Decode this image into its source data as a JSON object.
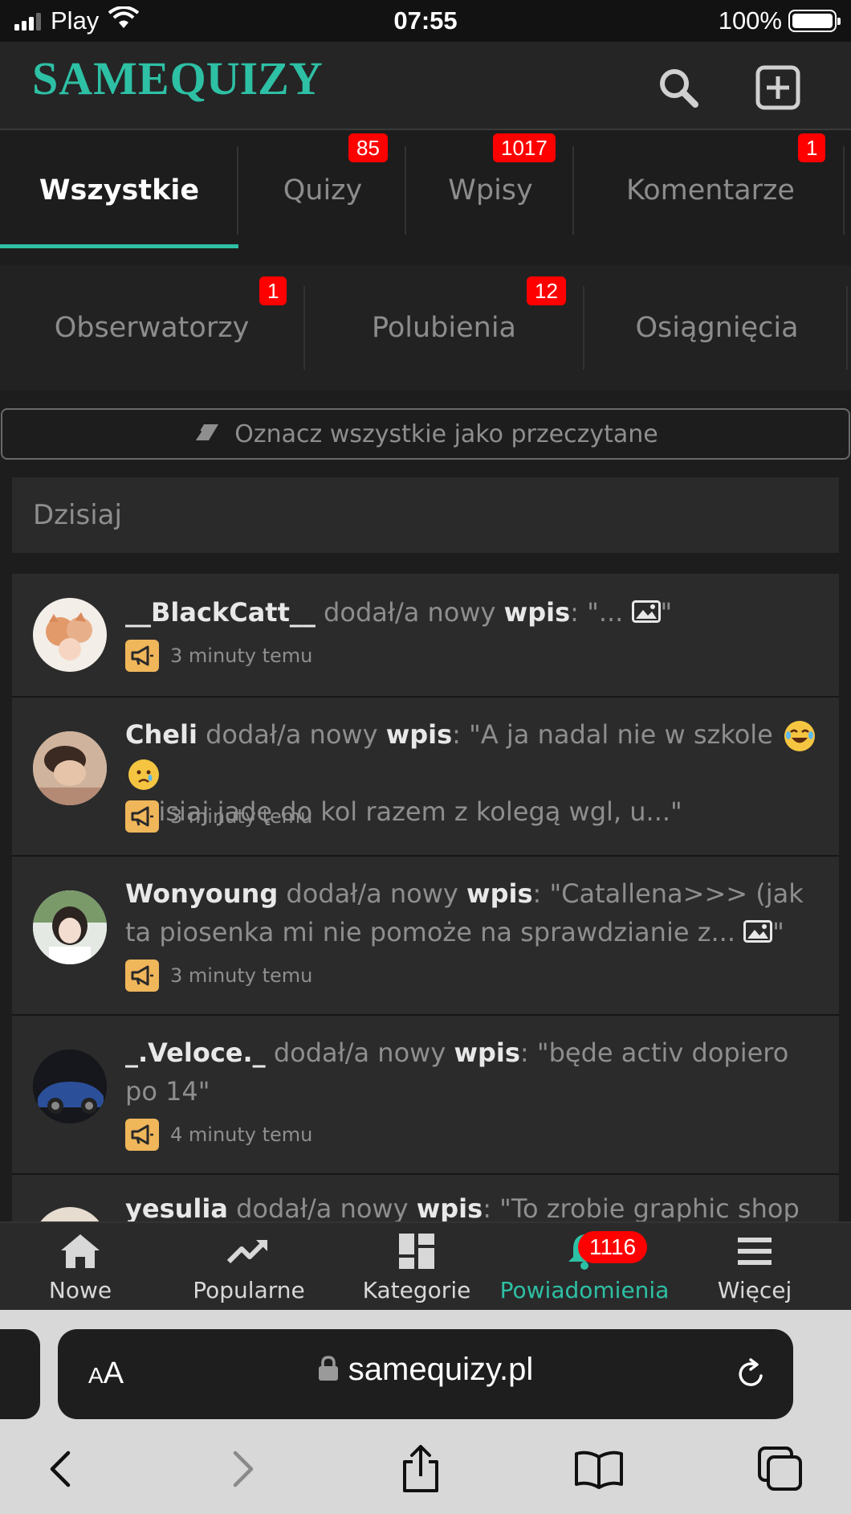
{
  "status_bar": {
    "carrier": "Play",
    "time": "07:55",
    "battery": "100%"
  },
  "header": {
    "logo_small": "SAME",
    "logo_big": "QUIZY",
    "search_icon": "search-icon",
    "add_icon": "plus-square-icon"
  },
  "tabs_row1": [
    {
      "label": "Wszystkie",
      "badge": ""
    },
    {
      "label": "Quizy",
      "badge": "85"
    },
    {
      "label": "Wpisy",
      "badge": "1017"
    },
    {
      "label": "Komentarze",
      "badge": "1"
    }
  ],
  "tabs_row2": [
    {
      "label": "Obserwatorzy",
      "badge": "1"
    },
    {
      "label": "Polubienia",
      "badge": "12"
    },
    {
      "label": "Osiągnięcia",
      "badge": ""
    }
  ],
  "mark_all_label": "Oznacz wszystkie jako przeczytane",
  "day_header": "Dzisiaj",
  "notifications": [
    {
      "user": "__BlackCatt__",
      "action": " dodał/a nowy ",
      "type": "wpis",
      "quote": ": \"... ",
      "quote_end": "\"",
      "time": "3 minuty temu"
    },
    {
      "user": "Cheli",
      "action": " dodał/a nowy ",
      "type": "wpis",
      "quote": ": \"A ja nadal nie w szkole ",
      "quote_end": "Dzisiaj jadę do kol razem z kolegą wgl, u...\"",
      "time": "3 minuty temu"
    },
    {
      "user": "Wonyoung",
      "action": " dodał/a nowy ",
      "type": "wpis",
      "quote": ": \"Catallena>>> (jak ta piosenka mi nie pomoże na sprawdzianie z... ",
      "quote_end": "\"",
      "time": "3 minuty temu"
    },
    {
      "user": "_.Veloce._",
      "action": " dodał/a nowy ",
      "type": "wpis",
      "quote": ": \"będe activ dopiero po 14\"",
      "quote_end": "",
      "time": "4 minuty temu"
    },
    {
      "user": "yesulia",
      "action": " dodał/a nowy ",
      "type": "wpis",
      "quote": ": \"To zrobie graphic shop",
      "quote_end": "",
      "time": ""
    }
  ],
  "bottom_nav": [
    {
      "label": "Nowe",
      "icon": "home-icon"
    },
    {
      "label": "Popularne",
      "icon": "trending-icon"
    },
    {
      "label": "Kategorie",
      "icon": "grid-icon"
    },
    {
      "label": "Powiadomienia",
      "icon": "bell-icon",
      "badge": "1116"
    },
    {
      "label": "Więcej",
      "icon": "menu-icon"
    }
  ],
  "browser": {
    "text_size": "AA",
    "url": "samequizy.pl"
  },
  "colors": {
    "accent": "#2ec0a5",
    "badge": "#ff0000",
    "megaphone": "#f0b65a"
  }
}
